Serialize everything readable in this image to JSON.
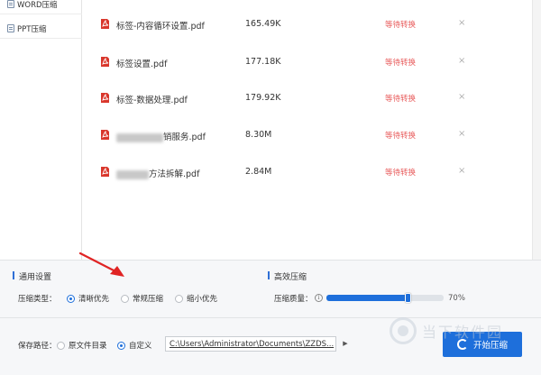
{
  "sidebar": {
    "items": [
      {
        "label": "WORD压缩"
      },
      {
        "label": "PPT压缩"
      }
    ]
  },
  "files": [
    {
      "name": "标签-内容循环设置.pdf",
      "size": "165.49K",
      "status": "等待转换"
    },
    {
      "name": "标签设置.pdf",
      "size": "177.18K",
      "status": "等待转换"
    },
    {
      "name": "标签-数据处理.pdf",
      "size": "179.92K",
      "status": "等待转换"
    },
    {
      "name_visible": "销服务.pdf",
      "size": "8.30M",
      "status": "等待转换"
    },
    {
      "name_visible": "方法拆解.pdf",
      "size": "2.84M",
      "status": "等待转换"
    }
  ],
  "icons": {
    "close": "×",
    "pdf": "pdf-icon",
    "info": "i",
    "dropdown": "▶"
  },
  "settings": {
    "general_title": "通用设置",
    "compress_type_label": "压缩类型：",
    "compress_types": [
      {
        "label": "清晰优先",
        "selected": true
      },
      {
        "label": "常规压缩",
        "selected": false
      },
      {
        "label": "缩小优先",
        "selected": false
      }
    ],
    "efficient_title": "高效压缩",
    "quality_label": "压缩质量：",
    "quality_value": 70,
    "quality_text": "70%"
  },
  "save": {
    "label": "保存路径：",
    "options": [
      {
        "label": "原文件目录",
        "selected": false
      },
      {
        "label": "自定义",
        "selected": true
      }
    ],
    "path": "C:\\Users\\Administrator\\Documents\\ZZDS..."
  },
  "start_button": {
    "label": "开始压缩"
  },
  "watermark": {
    "text": "当下软件园"
  },
  "colors": {
    "accent": "#1e6fdb",
    "status": "#e85c5c",
    "pdf_red": "#d9372c",
    "annotation_arrow": "#e02424"
  }
}
